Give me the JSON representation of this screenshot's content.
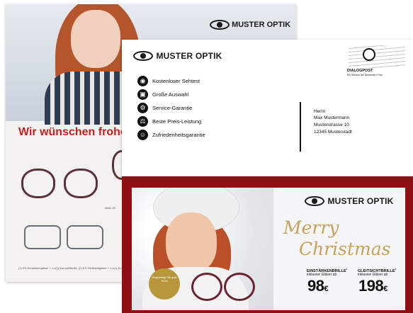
{
  "brand": "MUSTER OPTIK",
  "flyer": {
    "slogan": "Wir wünschen frohe W",
    "model_label": "0641-15",
    "footnote": "(1) KS-Einstärkengläser + x,x(1)-Komplettbrille, (2) KS-Gleitsichtgläser + x,x(1)-Komplettbrille"
  },
  "mailer": {
    "features": [
      {
        "icon": "eye-icon",
        "glyph": "◉",
        "label": "Kostenloser Sehtest"
      },
      {
        "icon": "shop-icon",
        "glyph": "▣",
        "label": "Große Auswahl"
      },
      {
        "icon": "service-icon",
        "glyph": "⚙",
        "label": "Service-Garantie"
      },
      {
        "icon": "scale-icon",
        "glyph": "⚖",
        "label": "Beste Preis-Leistung"
      },
      {
        "icon": "smile-icon",
        "glyph": "☺",
        "label": "Zufriedenheitsgarantie"
      }
    ],
    "address": {
      "salutation": "Herrn",
      "name": "Max Mustermann",
      "street": "Musterstrasse 10",
      "city": "12345 Musterstadt"
    },
    "postage": {
      "title": "DIALOGPOST",
      "subtitle": "Ein Service der Deutschen Post"
    }
  },
  "card": {
    "greeting_line1": "Merry",
    "greeting_line2": "Christmas",
    "badge_text": "Vergünstigt Sie gute Sicht",
    "offers": [
      {
        "title": "EINSTÄRKENBRILLE",
        "footnote": "1",
        "subtitle": "inklusive Gläser ab",
        "price": "98",
        "currency": "€"
      },
      {
        "title": "GLEITSICHTBRILLE",
        "footnote": "2",
        "subtitle": "inklusive Gläser ab",
        "price": "198",
        "currency": "€"
      }
    ]
  }
}
